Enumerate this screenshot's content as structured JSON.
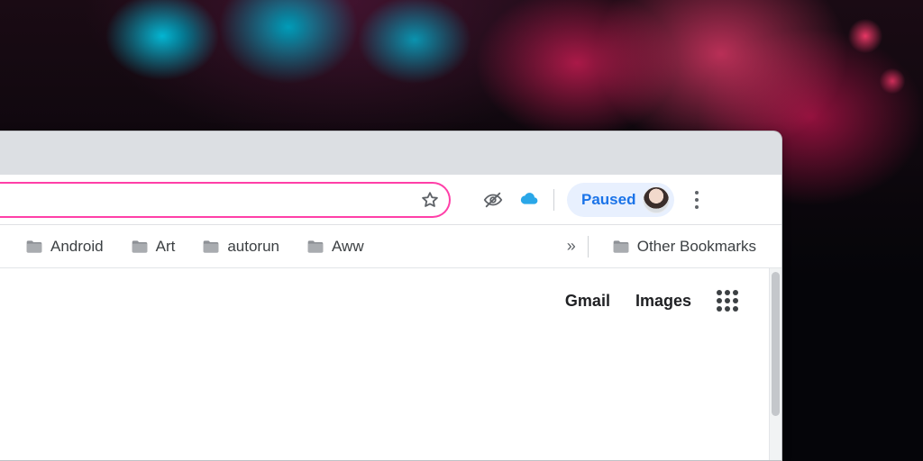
{
  "colors": {
    "omnibox_border": "#ff3fa8",
    "chip_bg": "#e8f0fe",
    "chip_text": "#1a73e8"
  },
  "toolbar": {
    "paused_label": "Paused"
  },
  "bookmarks_bar": {
    "items": [
      {
        "label": "Android"
      },
      {
        "label": "Art"
      },
      {
        "label": "autorun"
      },
      {
        "label": "Aww"
      }
    ],
    "other_label": "Other Bookmarks"
  },
  "ntp": {
    "gmail_label": "Gmail",
    "images_label": "Images"
  }
}
